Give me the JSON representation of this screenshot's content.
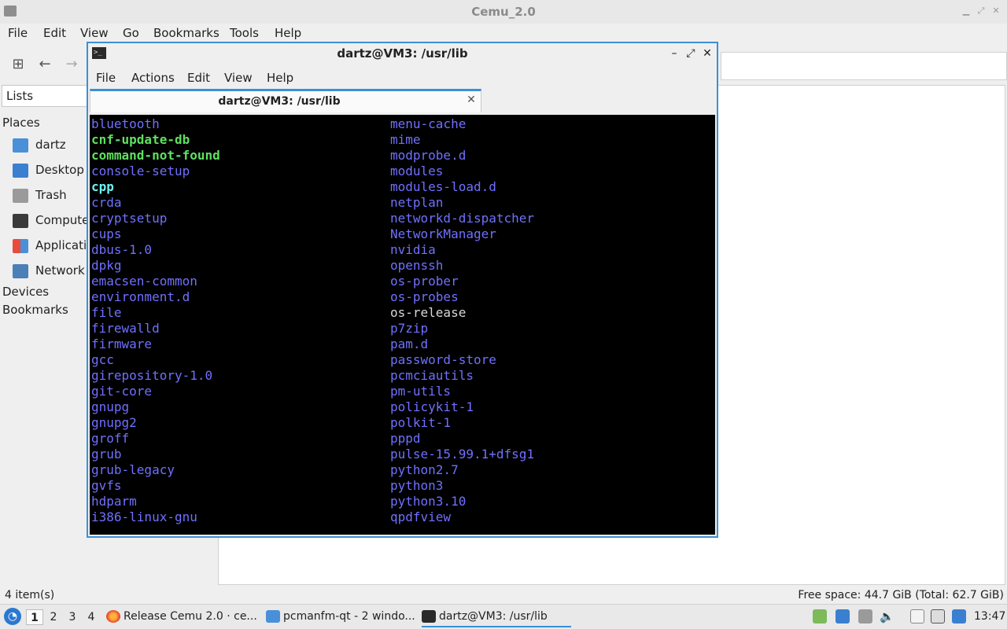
{
  "file_manager": {
    "title": "Cemu_2.0",
    "menu": [
      "File",
      "Edit",
      "View",
      "Go",
      "Bookmarks",
      "Tools",
      "Help"
    ],
    "side_pane_mode": "Lists",
    "places_header": "Places",
    "places": [
      {
        "label": "dartz",
        "icon": "home-folder-icon"
      },
      {
        "label": "Desktop",
        "icon": "desktop-icon"
      },
      {
        "label": "Trash",
        "icon": "trash-icon"
      },
      {
        "label": "Computer",
        "icon": "computer-icon"
      },
      {
        "label": "Applications",
        "icon": "applications-icon"
      },
      {
        "label": "Network",
        "icon": "network-icon"
      }
    ],
    "devices_header": "Devices",
    "bookmarks_header": "Bookmarks",
    "status_left": "4 item(s)",
    "status_right": "Free space: 44.7 GiB (Total: 62.7 GiB)"
  },
  "terminal": {
    "title": "dartz@VM3: /usr/lib",
    "menu": [
      "File",
      "Actions",
      "Edit",
      "View",
      "Help"
    ],
    "tab_label": "dartz@VM3: /usr/lib",
    "colors": {
      "dir": "#7070ff",
      "exec": "#5fe05f",
      "cyan": "#6ff0f0",
      "plain": "#d8d8d8"
    },
    "left_column": [
      {
        "name": "bluetooth",
        "kind": "dir"
      },
      {
        "name": "cnf-update-db",
        "kind": "exe"
      },
      {
        "name": "command-not-found",
        "kind": "exe"
      },
      {
        "name": "console-setup",
        "kind": "dir"
      },
      {
        "name": "cpp",
        "kind": "cyan"
      },
      {
        "name": "crda",
        "kind": "dir"
      },
      {
        "name": "cryptsetup",
        "kind": "dir"
      },
      {
        "name": "cups",
        "kind": "dir"
      },
      {
        "name": "dbus-1.0",
        "kind": "dir"
      },
      {
        "name": "dpkg",
        "kind": "dir"
      },
      {
        "name": "emacsen-common",
        "kind": "dir"
      },
      {
        "name": "environment.d",
        "kind": "dir"
      },
      {
        "name": "file",
        "kind": "dir"
      },
      {
        "name": "firewalld",
        "kind": "dir"
      },
      {
        "name": "firmware",
        "kind": "dir"
      },
      {
        "name": "gcc",
        "kind": "dir"
      },
      {
        "name": "girepository-1.0",
        "kind": "dir"
      },
      {
        "name": "git-core",
        "kind": "dir"
      },
      {
        "name": "gnupg",
        "kind": "dir"
      },
      {
        "name": "gnupg2",
        "kind": "dir"
      },
      {
        "name": "groff",
        "kind": "dir"
      },
      {
        "name": "grub",
        "kind": "dir"
      },
      {
        "name": "grub-legacy",
        "kind": "dir"
      },
      {
        "name": "gvfs",
        "kind": "dir"
      },
      {
        "name": "hdparm",
        "kind": "dir"
      },
      {
        "name": "i386-linux-gnu",
        "kind": "dir"
      }
    ],
    "right_column": [
      {
        "name": "menu-cache",
        "kind": "dir"
      },
      {
        "name": "mime",
        "kind": "dir"
      },
      {
        "name": "modprobe.d",
        "kind": "dir"
      },
      {
        "name": "modules",
        "kind": "dir"
      },
      {
        "name": "modules-load.d",
        "kind": "dir"
      },
      {
        "name": "netplan",
        "kind": "dir"
      },
      {
        "name": "networkd-dispatcher",
        "kind": "dir"
      },
      {
        "name": "NetworkManager",
        "kind": "dir"
      },
      {
        "name": "nvidia",
        "kind": "dir"
      },
      {
        "name": "openssh",
        "kind": "dir"
      },
      {
        "name": "os-prober",
        "kind": "dir"
      },
      {
        "name": "os-probes",
        "kind": "dir"
      },
      {
        "name": "os-release",
        "kind": "plain"
      },
      {
        "name": "p7zip",
        "kind": "dir"
      },
      {
        "name": "pam.d",
        "kind": "dir"
      },
      {
        "name": "password-store",
        "kind": "dir"
      },
      {
        "name": "pcmciautils",
        "kind": "dir"
      },
      {
        "name": "pm-utils",
        "kind": "dir"
      },
      {
        "name": "policykit-1",
        "kind": "dir"
      },
      {
        "name": "polkit-1",
        "kind": "dir"
      },
      {
        "name": "pppd",
        "kind": "dir"
      },
      {
        "name": "pulse-15.99.1+dfsg1",
        "kind": "dir"
      },
      {
        "name": "python2.7",
        "kind": "dir"
      },
      {
        "name": "python3",
        "kind": "dir"
      },
      {
        "name": "python3.10",
        "kind": "dir"
      },
      {
        "name": "qpdfview",
        "kind": "dir"
      }
    ]
  },
  "taskbar": {
    "desktops": [
      "1",
      "2",
      "3",
      "4"
    ],
    "tasks": [
      {
        "label": "Release Cemu 2.0 · ce...",
        "icon": "firefox-icon"
      },
      {
        "label": "pcmanfm-qt - 2 windo...",
        "icon": "folder-icon"
      },
      {
        "label": "dartz@VM3: /usr/lib",
        "icon": "terminal-icon"
      }
    ],
    "clock": "13:47"
  }
}
